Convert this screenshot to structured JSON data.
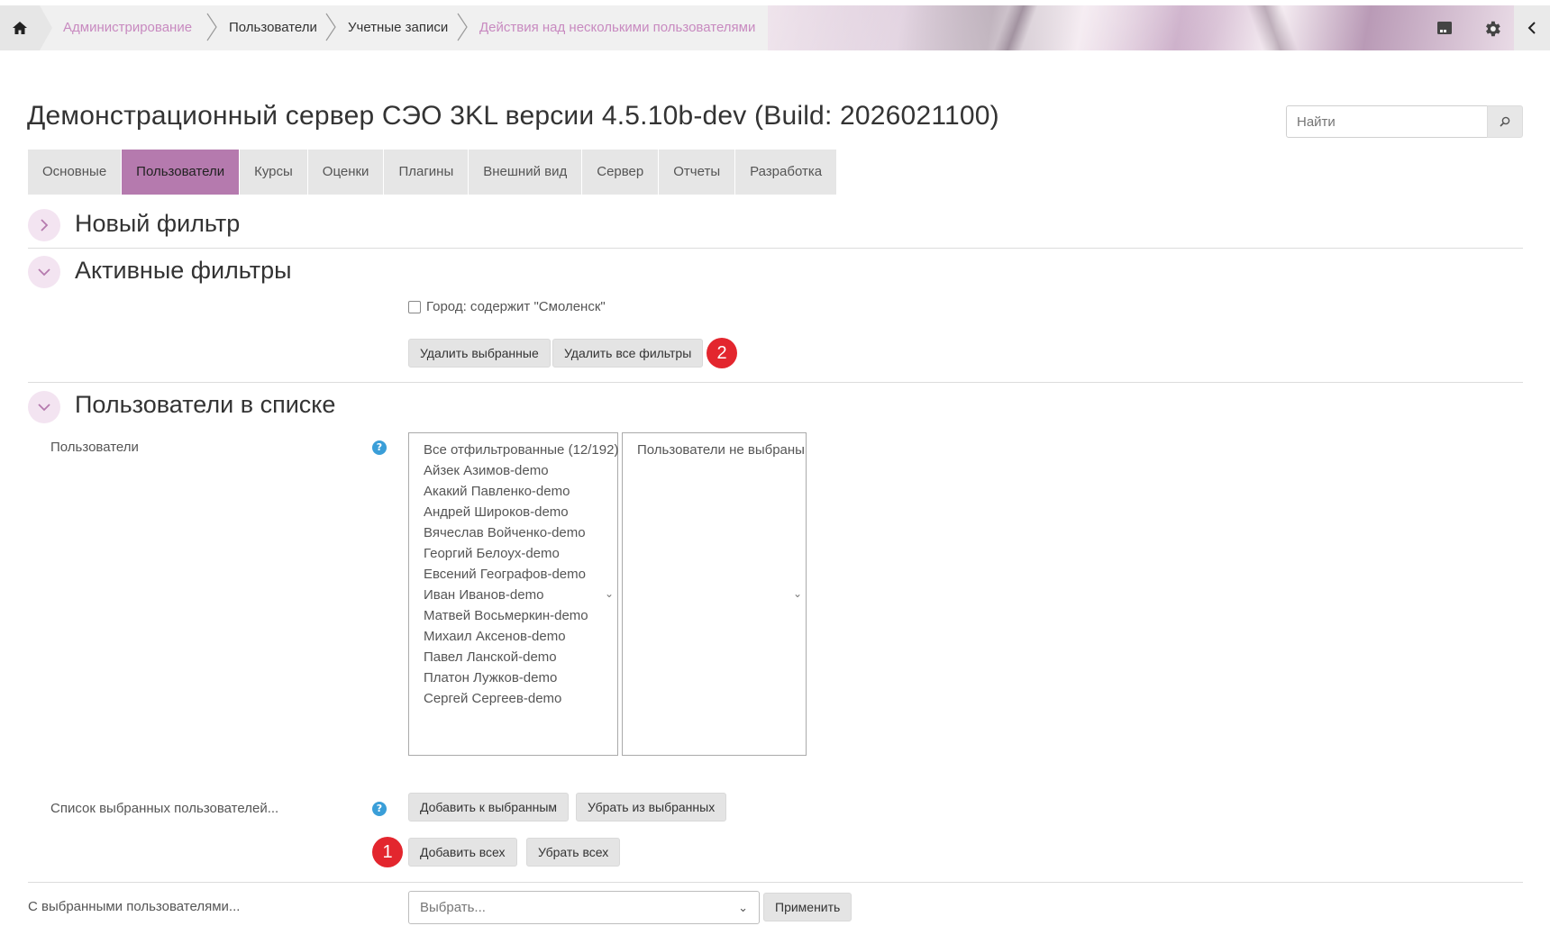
{
  "breadcrumb": [
    {
      "label": "Администрирование",
      "style": "link"
    },
    {
      "label": "Пользователи",
      "style": "dark"
    },
    {
      "label": "Учетные записи",
      "style": "dark"
    },
    {
      "label": "Действия над несколькими пользователями",
      "style": "link"
    }
  ],
  "icons": {
    "home": "home-icon",
    "save": "floppy-icon",
    "settings": "gear-icon",
    "collapse": "chevron-left-icon",
    "search": "magnifier-icon"
  },
  "header": {
    "title": "Демонстрационный сервер СЭО 3KL версии 4.5.10b-dev (Build: 2026021100)",
    "search_placeholder": "Найти"
  },
  "tabs": [
    {
      "label": "Основные",
      "active": false
    },
    {
      "label": "Пользователи",
      "active": true
    },
    {
      "label": "Курсы",
      "active": false
    },
    {
      "label": "Оценки",
      "active": false
    },
    {
      "label": "Плагины",
      "active": false
    },
    {
      "label": "Внешний вид",
      "active": false
    },
    {
      "label": "Сервер",
      "active": false
    },
    {
      "label": "Отчеты",
      "active": false
    },
    {
      "label": "Разработка",
      "active": false
    }
  ],
  "sections": {
    "new_filter": {
      "title": "Новый фильтр",
      "expanded": false
    },
    "active_filters": {
      "title": "Активные фильтры",
      "expanded": true,
      "filter_label": "Город: содержит \"Смоленск\"",
      "filter_checked": false,
      "remove_selected": "Удалить выбранные",
      "remove_all": "Удалить все фильтры",
      "badge": "2"
    },
    "users_in_list": {
      "title": "Пользователи в списке",
      "expanded": true,
      "users_label": "Пользователи",
      "available": [
        "Все отфильтрованные (12/192)",
        "Айзек Азимов-demo",
        "Акакий Павленко-demo",
        "Андрей Широков-demo",
        "Вячеслав Войченко-demo",
        "Георгий Белоух-demo",
        "Евсений Географов-demo",
        "Иван Иванов-demo",
        "Матвей Восьмеркин-demo",
        "Михаил Аксенов-demo",
        "Павел Ланской-demo",
        "Платон Лужков-demo",
        "Сергей Сергеев-demo"
      ],
      "selected": [
        "Пользователи не выбраны"
      ],
      "selected_list_label": "Список выбранных пользователей...",
      "add_to_selected": "Добавить к выбранным",
      "remove_from_selected": "Убрать из выбранных",
      "add_all": "Добавить всех",
      "remove_all": "Убрать всех",
      "badge": "1"
    },
    "with_selected": {
      "label": "С выбранными пользователями...",
      "select_value": "Выбрать...",
      "apply": "Применить"
    }
  },
  "colors": {
    "accent": "#b57aae",
    "link": "#c88ac0",
    "badge": "#e3262e",
    "help": "#3a9ed8"
  }
}
